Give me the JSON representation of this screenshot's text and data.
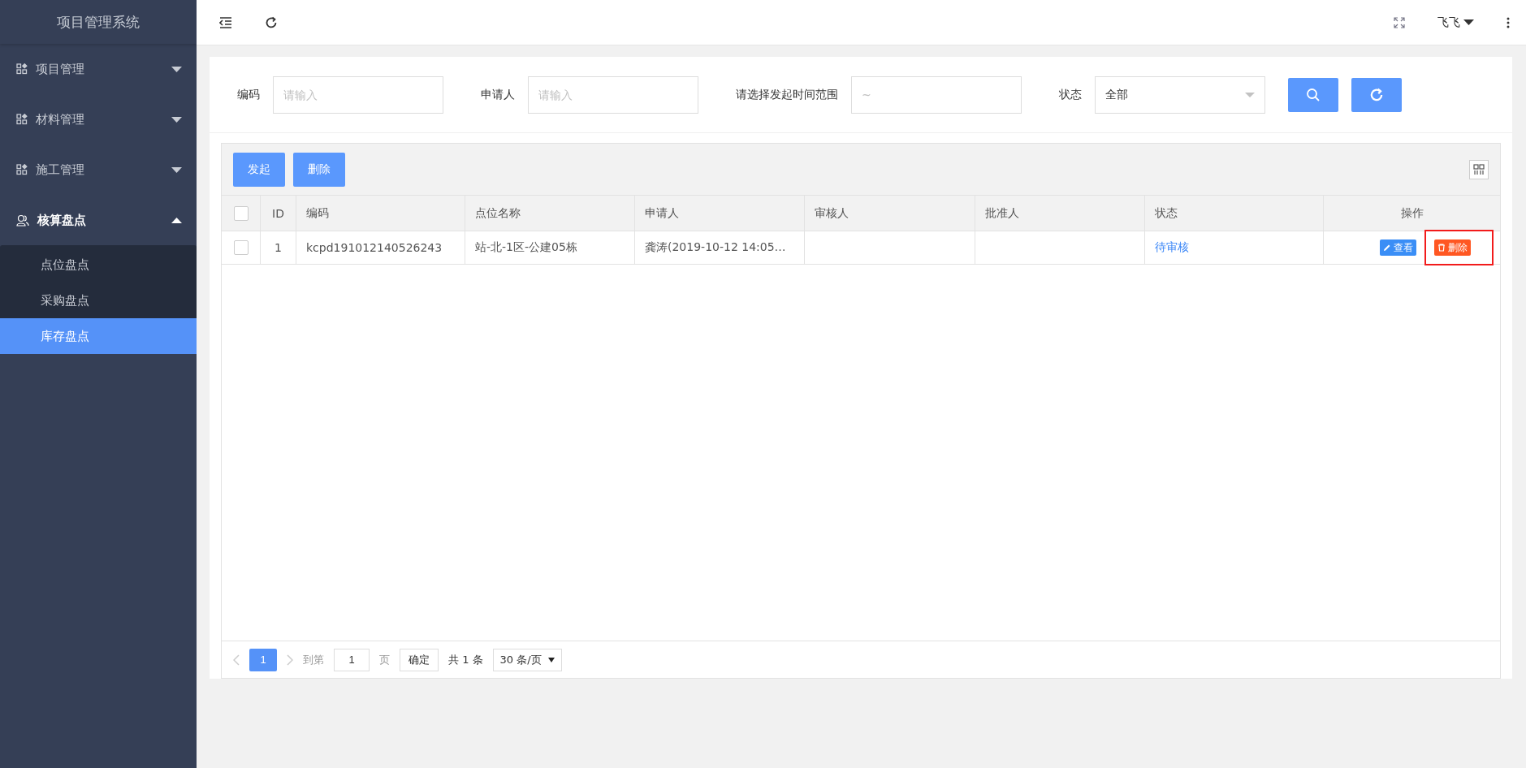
{
  "sidebar": {
    "title": "项目管理系统",
    "groups": [
      {
        "label": "项目管理",
        "kind": "module",
        "expanded": false
      },
      {
        "label": "材料管理",
        "kind": "module",
        "expanded": false
      },
      {
        "label": "施工管理",
        "kind": "module",
        "expanded": false
      },
      {
        "label": "核算盘点",
        "kind": "people",
        "expanded": true,
        "children": [
          {
            "label": "点位盘点",
            "selected": false
          },
          {
            "label": "采购盘点",
            "selected": false
          },
          {
            "label": "库存盘点",
            "selected": true
          }
        ]
      }
    ]
  },
  "topbar": {
    "user": "飞飞"
  },
  "filters": [
    {
      "label": "编码",
      "kind": "input",
      "placeholder": "请输入"
    },
    {
      "label": "申请人",
      "kind": "input",
      "placeholder": "请输入"
    },
    {
      "label": "请选择发起时间范围",
      "kind": "range",
      "placeholder": "~"
    },
    {
      "label": "状态",
      "kind": "select",
      "value": "全部"
    }
  ],
  "toolbar": {
    "buttons": [
      "发起",
      "删除"
    ]
  },
  "table": {
    "all_checked": false,
    "columns": [
      "ID",
      "编码",
      "点位名称",
      "申请人",
      "审核人",
      "批准人",
      "状态",
      "操作"
    ],
    "rows": [
      {
        "checked": false,
        "cells": [
          "1",
          "kcpd191012140526243",
          "站-北-1区-公建05栋",
          "龚涛(2019-10-12 14:05…",
          "",
          "",
          "待审核"
        ],
        "actions": [
          {
            "label": "查看",
            "kind": "view",
            "highlighted": false
          },
          {
            "label": "删除",
            "kind": "delete",
            "highlighted": true
          }
        ]
      }
    ]
  },
  "pagination": {
    "pages": [
      {
        "label": "1",
        "selected": true
      }
    ],
    "goto_label": "到第",
    "goto_value": "1",
    "page_unit": "页",
    "confirm": "确定",
    "total": "共 1 条",
    "page_size": "30 条/页"
  }
}
